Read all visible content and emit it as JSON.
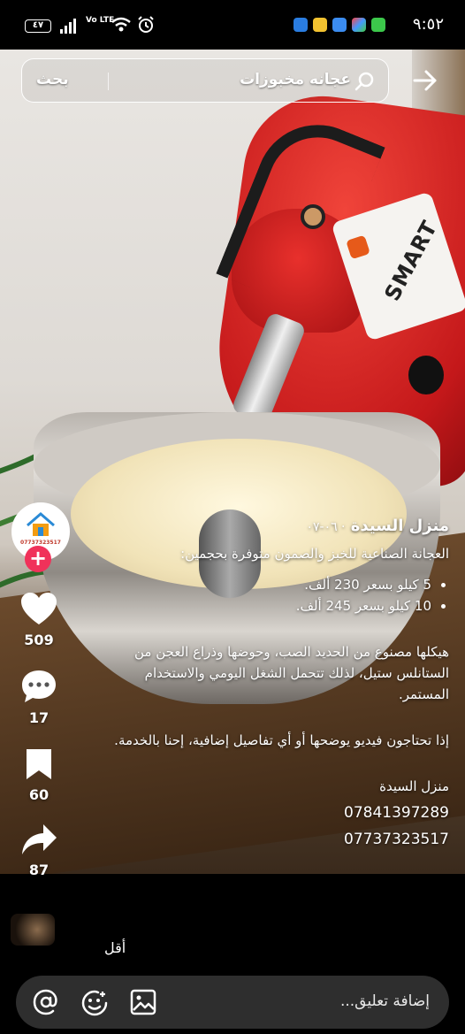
{
  "status_bar": {
    "battery": "٤٧",
    "network": "Vo LTE",
    "time": "٩:٥٢"
  },
  "search": {
    "button_label": "بحث",
    "query": "عجانه مخبوزات"
  },
  "actions": {
    "likes": "509",
    "comments": "17",
    "saves": "60",
    "shares": "87"
  },
  "avatar": {
    "text": "07737323517"
  },
  "post": {
    "author": "منزل السيدة",
    "date": "٠٦-٠٧",
    "intro": "العجانة الصناعية للخبز والصمون متوفرة بحجمين:",
    "bullets": [
      "5 كيلو بسعر 230 ألف.",
      "10 كيلو بسعر 245 ألف."
    ],
    "paragraph1": "هيكلها مصنوع من الحديد الصب، وحوضها وذراع العجن من الستانلس ستيل، لذلك تتحمل الشغل اليومي والاستخدام المستمر.",
    "paragraph2": "إذا تحتاجون فيديو يوضحها أو أي تفاصيل إضافية، إحنا بالخدمة.",
    "signature": "منزل السيدة",
    "phone1": "07841397289",
    "phone2": "07737323517",
    "less_label": "أقل"
  },
  "comment_bar": {
    "placeholder": "إضافة تعليق..."
  },
  "colors": {
    "background": "#000000",
    "follow_badge": "#f0325a",
    "comment_bar": "#2e2e2e"
  }
}
